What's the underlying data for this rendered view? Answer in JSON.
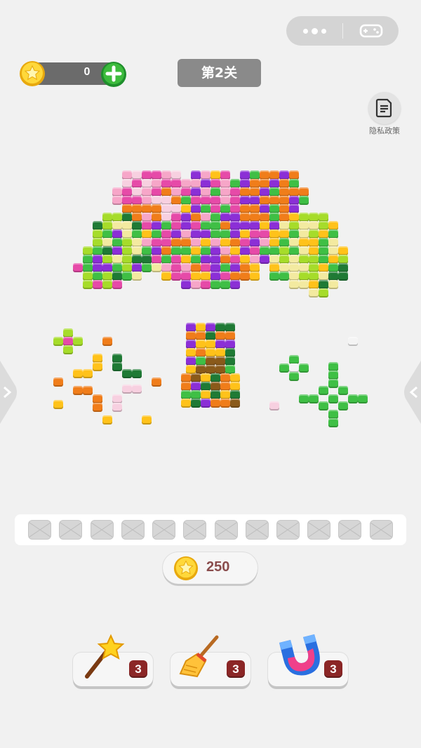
{
  "header": {
    "coins": "0",
    "level_label": "第2关",
    "privacy_label": "隐私政策"
  },
  "menu_capsule": {
    "more_icon": "more-dots-icon",
    "game_icon": "gamepad-icon"
  },
  "tray": {
    "slot_count": 12
  },
  "reward": {
    "amount": "250"
  },
  "powerups": [
    {
      "name": "magic-wand",
      "icon": "star-wand-icon",
      "count": "3"
    },
    {
      "name": "broom",
      "icon": "broom-icon",
      "count": "3"
    },
    {
      "name": "magnet",
      "icon": "magnet-icon",
      "count": "3"
    }
  ],
  "colors": {
    "orange": "#f07d1a",
    "purple": "#8b2fd6",
    "magenta": "#e64aa8",
    "pink": "#f6a6c8",
    "lightpink": "#f7d0e0",
    "green": "#3fbf45",
    "darkgreen": "#1f7a35",
    "lime": "#a6dc2a",
    "yellow": "#ffc21a",
    "cream": "#f3eaa0",
    "brown": "#8a5a1a",
    "white": "#f4f4f4"
  }
}
